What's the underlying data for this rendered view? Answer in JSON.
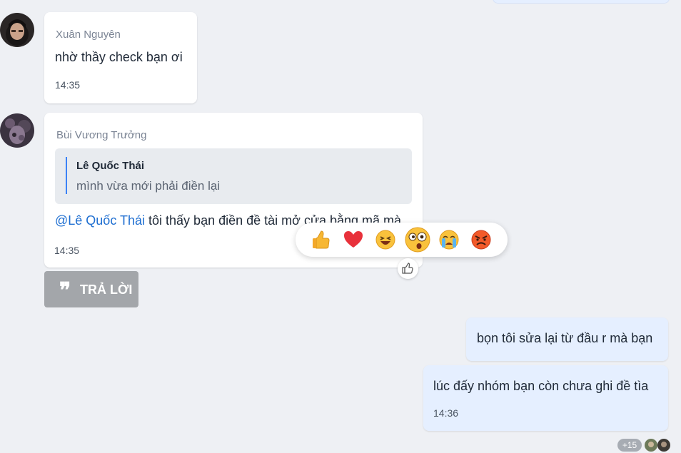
{
  "messages": [
    {
      "sender": "Xuân Nguyên",
      "text": "nhờ thầy check bạn ơi",
      "time": "14:35"
    },
    {
      "sender": "Bùi Vương Trưởng",
      "quote": {
        "name": "Lê Quốc Thái",
        "text": "mình vừa mới phải điền lại"
      },
      "mention": "@Lê Quốc Thái",
      "text": " tôi thấy bạn điền đề tài mở cửa bằng mã mà",
      "time": "14:35"
    }
  ],
  "reply_button": {
    "label": "TRẢ LỜI",
    "icon": "quote-icon"
  },
  "reactions": [
    "thumbs-up",
    "heart",
    "laughing",
    "surprised",
    "crying",
    "angry"
  ],
  "my_messages": [
    {
      "text": "bọn tôi sửa lại từ đầu r mà bạn"
    },
    {
      "text": "lúc đấy nhóm bạn còn chưa ghi đề tìa",
      "time": "14:36"
    }
  ],
  "seen": {
    "count": "+15"
  }
}
